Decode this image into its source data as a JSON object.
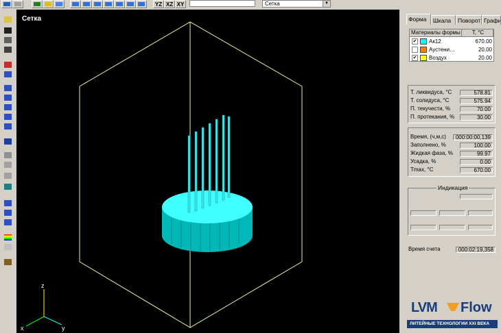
{
  "toolbar": {
    "yz_label": "YZ",
    "xz_label": "XZ",
    "xy_label": "XY",
    "view_mode": "Сетка"
  },
  "viewport": {
    "title": "Сетка",
    "axis_z": "z",
    "axis_x": "x",
    "axis_y": "y"
  },
  "tabs": [
    "Форма",
    "Шкала",
    "Поворот",
    "Графи"
  ],
  "materials": {
    "header_name": "Материалы формы",
    "header_temp": "T, °C",
    "items": [
      {
        "checked": "✔",
        "color": "#00ffff",
        "name": "Ак12",
        "temp": "670.00"
      },
      {
        "checked": "",
        "color": "#ff8000",
        "name": "Аустени…",
        "temp": "20.00"
      },
      {
        "checked": "✔",
        "color": "#ffff00",
        "name": "Воздух",
        "temp": "20.00"
      }
    ]
  },
  "props": [
    {
      "label": "Т. ликвидуса, °С",
      "value": "578.81"
    },
    {
      "label": "Т. солидуса, °С",
      "value": "575.94"
    },
    {
      "label": "П. текучести, %",
      "value": "70.00"
    },
    {
      "label": "П. протекания, %",
      "value": "30.00"
    }
  ],
  "sim": {
    "time_label": "Время, (ч,м,с)",
    "time_value": "000:00:00,139",
    "rows": [
      {
        "label": "Заполнено, %",
        "value": "100.00"
      },
      {
        "label": "Жидкая фаза, %",
        "value": "99.97"
      },
      {
        "label": "Усадка, %",
        "value": "0.00"
      },
      {
        "label": "Tmax, °C",
        "value": "670.00"
      }
    ]
  },
  "indication": {
    "title": "Индикация"
  },
  "calc": {
    "label": "Время счета",
    "value": "000:02:19,358"
  },
  "logo": {
    "left": "LVM",
    "right": "Flow",
    "tagline": "ЛИТЕЙНЫЕ ТЕХНОЛОГИИ XXI ВЕКА"
  }
}
